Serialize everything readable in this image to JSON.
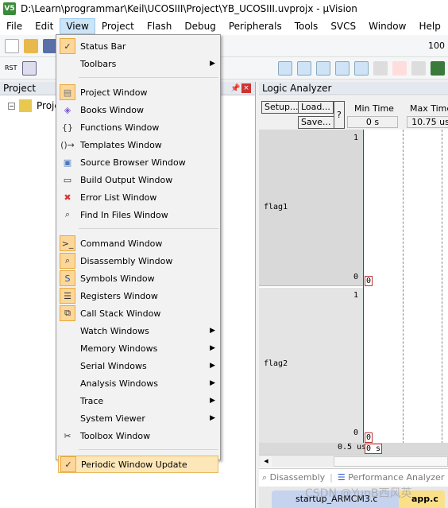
{
  "title": "D:\\Learn\\programmar\\Keil\\UCOSIII\\Project\\YB_UCOSIII.uvprojx - µVision",
  "menubar": [
    "File",
    "Edit",
    "View",
    "Project",
    "Flash",
    "Debug",
    "Peripherals",
    "Tools",
    "SVCS",
    "Window",
    "Help"
  ],
  "toolbar": {
    "zoom_value": "100",
    "rst_label": "RST"
  },
  "project_panel": {
    "title": "Project",
    "root": "Proje"
  },
  "logic_analyzer": {
    "title": "Logic Analyzer",
    "setup": "Setup...",
    "load": "Load...",
    "save": "Save...",
    "help": "?",
    "min_time_label": "Min Time",
    "min_time": "0 s",
    "max_time_label": "Max Time",
    "max_time": "10.75 us",
    "signals": [
      {
        "name": "flag1",
        "high": "1",
        "low": "0",
        "cursor_value": "0"
      },
      {
        "name": "flag2",
        "high": "1",
        "low": "0",
        "cursor_value": "0"
      }
    ],
    "time_scale": "0.5 us",
    "cursor_time": "0 s"
  },
  "bottom_tabs": [
    "Disassembly",
    "Performance Analyzer"
  ],
  "file_tabs": [
    "startup_ARMCM3.c",
    "app.c"
  ],
  "watermark": "CSDN @YunB西风英",
  "view_menu": [
    {
      "label": "Status Bar",
      "icon": "check-icon",
      "checked": true
    },
    {
      "label": "Toolbars",
      "submenu": true
    },
    {
      "sep": true
    },
    {
      "label": "Project Window",
      "icon": "project-window-icon"
    },
    {
      "label": "Books Window",
      "icon": "books-icon"
    },
    {
      "label": "Functions Window",
      "icon": "braces-icon"
    },
    {
      "label": "Templates Window",
      "icon": "templates-icon"
    },
    {
      "label": "Source Browser Window",
      "icon": "source-browser-icon"
    },
    {
      "label": "Build Output Window",
      "icon": "build-output-icon"
    },
    {
      "label": "Error List Window",
      "icon": "error-x-icon"
    },
    {
      "label": "Find In Files Window",
      "icon": "find-icon"
    },
    {
      "sep": true
    },
    {
      "label": "Command Window",
      "icon": "command-icon"
    },
    {
      "label": "Disassembly Window",
      "icon": "disassembly-icon"
    },
    {
      "label": "Symbols Window",
      "icon": "symbols-icon"
    },
    {
      "label": "Registers Window",
      "icon": "registers-icon"
    },
    {
      "label": "Call Stack Window",
      "icon": "call-stack-icon"
    },
    {
      "label": "Watch Windows",
      "submenu": true
    },
    {
      "label": "Memory Windows",
      "submenu": true
    },
    {
      "label": "Serial Windows",
      "submenu": true
    },
    {
      "label": "Analysis Windows",
      "submenu": true
    },
    {
      "label": "Trace",
      "submenu": true
    },
    {
      "label": "System Viewer",
      "submenu": true
    },
    {
      "label": "Toolbox Window",
      "icon": "toolbox-icon"
    },
    {
      "sep": true
    },
    {
      "label": "Periodic Window Update",
      "icon": "check-icon",
      "checked": true,
      "highlighted": true
    }
  ]
}
